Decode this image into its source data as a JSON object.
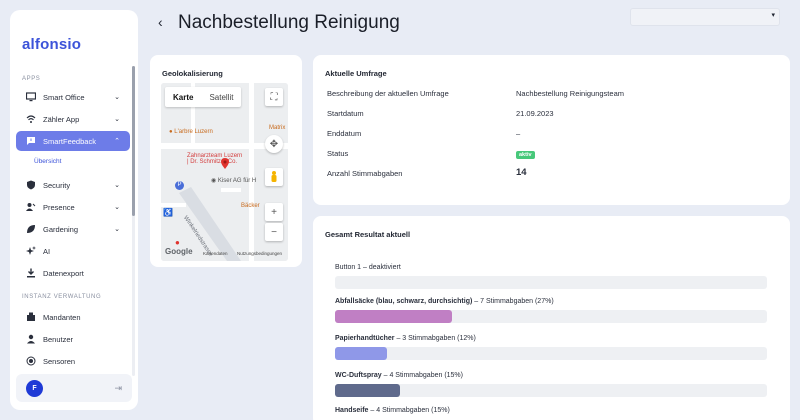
{
  "brand": {
    "logo_text": "alfonsio",
    "accent": "#3c53d9"
  },
  "sidebar": {
    "apps_label": "APPS",
    "items": [
      {
        "label": "Smart Office",
        "icon": "monitor-icon",
        "expandable": true
      },
      {
        "label": "Zähler App",
        "icon": "wifi-icon",
        "expandable": true
      },
      {
        "label": "SmartFeedback",
        "icon": "feedback-icon",
        "expandable": true,
        "active": true
      },
      {
        "label": "Security",
        "icon": "shield-icon",
        "expandable": true
      },
      {
        "label": "Presence",
        "icon": "presence-icon",
        "expandable": true
      },
      {
        "label": "Gardening",
        "icon": "leaf-icon",
        "expandable": true
      },
      {
        "label": "AI",
        "icon": "sparkle-icon",
        "expandable": false
      },
      {
        "label": "Datenexport",
        "icon": "download-icon",
        "expandable": false
      }
    ],
    "subitem": "Übersicht",
    "instanz_label": "INSTANZ VERWALTUNG",
    "instanz_items": [
      {
        "label": "Mandanten",
        "icon": "building-icon"
      },
      {
        "label": "Benutzer",
        "icon": "user-icon"
      },
      {
        "label": "Sensoren",
        "icon": "sensor-icon"
      }
    ],
    "user_initial": "F"
  },
  "header": {
    "title": "Nachbestellung Reinigung"
  },
  "geo": {
    "title": "Geolokalisierung",
    "tab_map": "Karte",
    "tab_satellite": "Satellit",
    "labels": {
      "arbre": "L'arbre Luzern",
      "zahnarzt_1": "Zahnarzteam Luzern",
      "zahnarzt_2": "| Dr. Schmitz + Co.",
      "kiser": "Kiser AG für H",
      "baecker": "Bäcker",
      "matrix": "Matrix",
      "street": "Winkelriedstrasse",
      "google": "Google",
      "kartendaten": "Kartendaten",
      "nutzung": "Nutzungsbedingungen"
    }
  },
  "survey": {
    "title": "Aktuelle Umfrage",
    "rows": [
      {
        "label": "Beschreibung der aktuellen Umfrage",
        "value": "Nachbestellung Reinigungsteam"
      },
      {
        "label": "Startdatum",
        "value": "21.09.2023"
      },
      {
        "label": "Enddatum",
        "value": "–"
      },
      {
        "label": "Status",
        "value": "aktiv"
      },
      {
        "label": "Anzahl Stimmabgaben",
        "value": "14"
      }
    ]
  },
  "results": {
    "title": "Gesamt Resultat aktuell",
    "items": [
      {
        "name": "Button 1 – deaktiviert",
        "suffix": "",
        "percent": 0,
        "color": "#eef0f3"
      },
      {
        "name": "Abfallsäcke (blau, schwarz, durchsichtig)",
        "suffix": " – 7 Stimmabgaben (27%)",
        "percent": 27,
        "color": "#c07fc4"
      },
      {
        "name": "Papierhandtücher",
        "suffix": " – 3 Stimmabgaben (12%)",
        "percent": 12,
        "color": "#8f98e8"
      },
      {
        "name": "WC-Duftspray",
        "suffix": " – 4 Stimmabgaben (15%)",
        "percent": 15,
        "color": "#5f6a8c"
      },
      {
        "name": "Handseife",
        "suffix": " – 4 Stimmabgaben (15%)",
        "percent": 15,
        "color": "#a8b4e8"
      }
    ]
  }
}
